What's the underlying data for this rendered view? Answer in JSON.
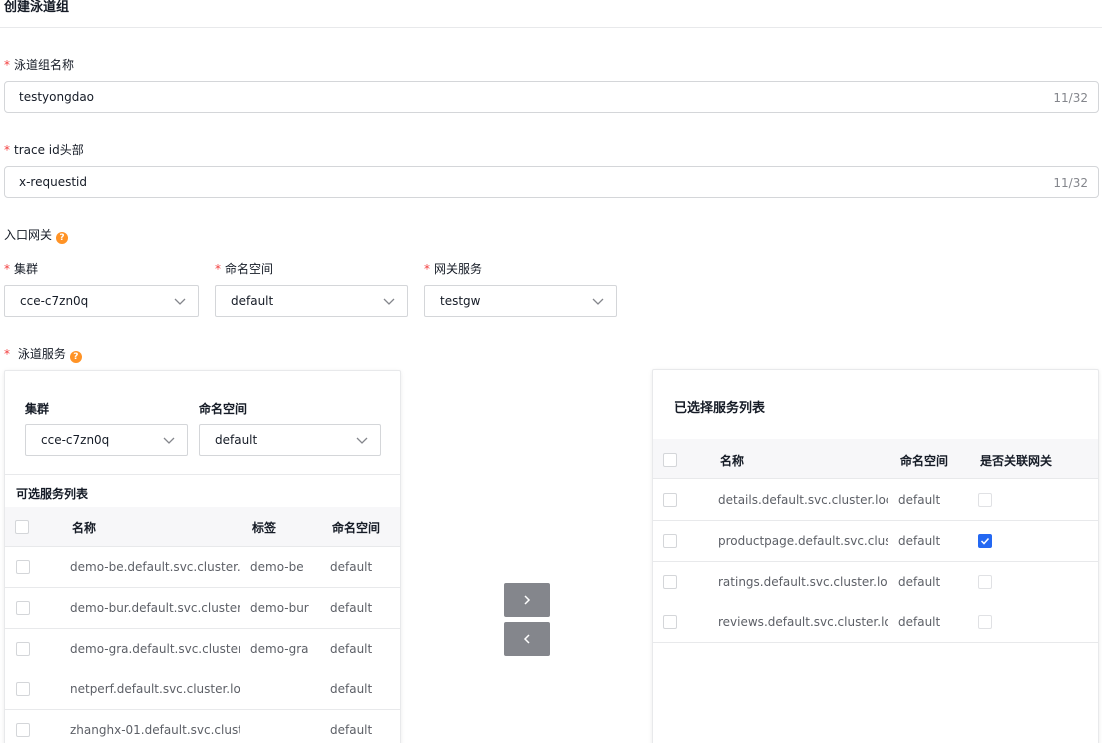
{
  "page": {
    "title": "创建泳道组"
  },
  "form": {
    "lane_group_name": {
      "label": "泳道组名称",
      "value": "testyongdao",
      "counter": "11/32"
    },
    "trace_id_header": {
      "label": "trace id头部",
      "value": "x-requestid",
      "counter": "11/32"
    },
    "ingress_gateway": {
      "label": "入口网关",
      "cluster": {
        "label": "集群",
        "value": "cce-c7zn0q"
      },
      "namespace": {
        "label": "命名空间",
        "value": "default"
      },
      "gateway_service": {
        "label": "网关服务",
        "value": "testgw"
      }
    },
    "lane_services": {
      "label": "泳道服务"
    }
  },
  "left_panel": {
    "cluster": {
      "label": "集群",
      "value": "cce-c7zn0q"
    },
    "namespace": {
      "label": "命名空间",
      "value": "default"
    },
    "list_title": "可选服务列表",
    "columns": [
      "名称",
      "标签",
      "命名空间"
    ],
    "rows": [
      {
        "name": "demo-be.default.svc.cluster.l...",
        "tag": "demo-be",
        "namespace": "default"
      },
      {
        "name": "demo-bur.default.svc.cluster...",
        "tag": "demo-bur",
        "namespace": "default"
      },
      {
        "name": "demo-gra.default.svc.cluster...",
        "tag": "demo-gra",
        "namespace": "default"
      },
      {
        "name": "netperf.default.svc.cluster.lo...",
        "tag": "",
        "namespace": "default"
      },
      {
        "name": "zhanghx-01.default.svc.clust...",
        "tag": "",
        "namespace": "default"
      }
    ]
  },
  "right_panel": {
    "title": "已选择服务列表",
    "columns": [
      "名称",
      "命名空间",
      "是否关联网关"
    ],
    "rows": [
      {
        "name": "details.default.svc.cluster.local",
        "namespace": "default",
        "linked": false
      },
      {
        "name": "productpage.default.svc.clus...",
        "namespace": "default",
        "linked": true
      },
      {
        "name": "ratings.default.svc.cluster.local",
        "namespace": "default",
        "linked": false
      },
      {
        "name": "reviews.default.svc.cluster.lo...",
        "namespace": "default",
        "linked": false
      }
    ]
  },
  "icons": {
    "move_right": "chevron-right-icon",
    "move_left": "chevron-left-icon",
    "help": "question-circle-icon",
    "dropdown": "chevron-down-icon"
  },
  "colors": {
    "primary": "#2468f2",
    "required": "#f33e3e",
    "help": "#ff9326",
    "transfer_button": "#84868c"
  }
}
